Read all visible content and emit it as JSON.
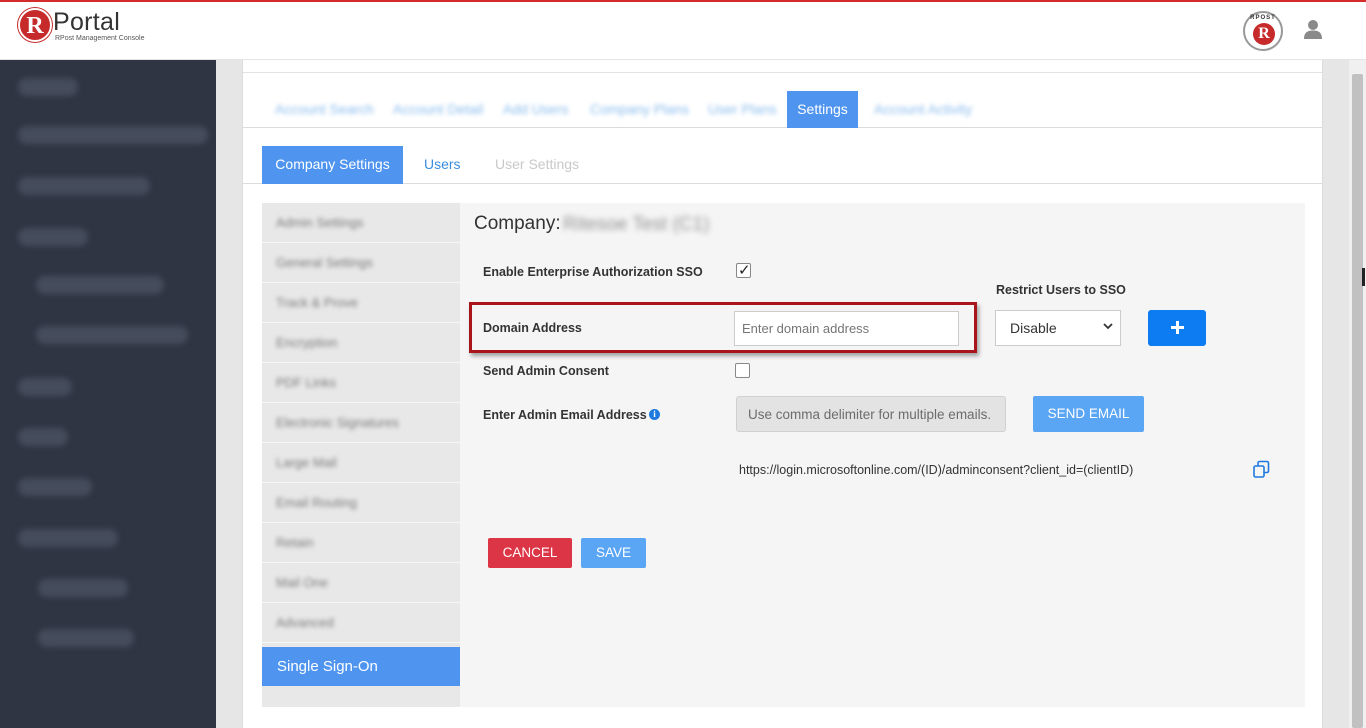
{
  "header": {
    "logo_letter": "R",
    "app_title": "Portal",
    "app_subtitle": "RPost Management Console",
    "badge_text": "RPOST",
    "badge_letter": "R"
  },
  "top_tabs": {
    "active_label": "Settings",
    "blurred": [
      "Account Search",
      "Account Detail",
      "Add Users",
      "Company Plans",
      "User Plans",
      "Account Activity"
    ]
  },
  "sub_tabs": {
    "company_settings": "Company Settings",
    "users": "Users",
    "user_settings": "User Settings"
  },
  "left_menu": {
    "items": [
      "Admin Settings",
      "General Settings",
      "Track & Prove",
      "Encryption",
      "PDF Links",
      "Electronic Signatures",
      "Large Mail",
      "Email Routing",
      "Retain",
      "Mail One",
      "Advanced"
    ],
    "active_label": "Single Sign-On"
  },
  "sso": {
    "company_label": "Company:",
    "company_name": "Ritesoe Test (C1)",
    "enable_label": "Enable Enterprise Authorization SSO",
    "enable_checked": true,
    "domain_label": "Domain Address",
    "domain_placeholder": "Enter domain address",
    "domain_value": "",
    "restrict_label": "Restrict Users to SSO",
    "restrict_value": "Disable",
    "send_consent_label": "Send Admin Consent",
    "send_consent_checked": false,
    "admin_email_label": "Enter Admin Email Address",
    "admin_email_placeholder": "Use comma delimiter for multiple emails.",
    "send_email_label": "SEND EMAIL",
    "consent_url": "https://login.microsoftonline.com/(ID)/adminconsent?client_id=(clientID)",
    "cancel_label": "CANCEL",
    "save_label": "SAVE"
  },
  "colors": {
    "accent": "#4f95f0",
    "sidebar": "#2f3543",
    "danger": "#dc3545",
    "highlight": "#a8161b"
  },
  "icons": [
    "user-icon",
    "plus-icon",
    "info-icon",
    "copy-icon",
    "chevron-down-icon",
    "check-icon"
  ]
}
